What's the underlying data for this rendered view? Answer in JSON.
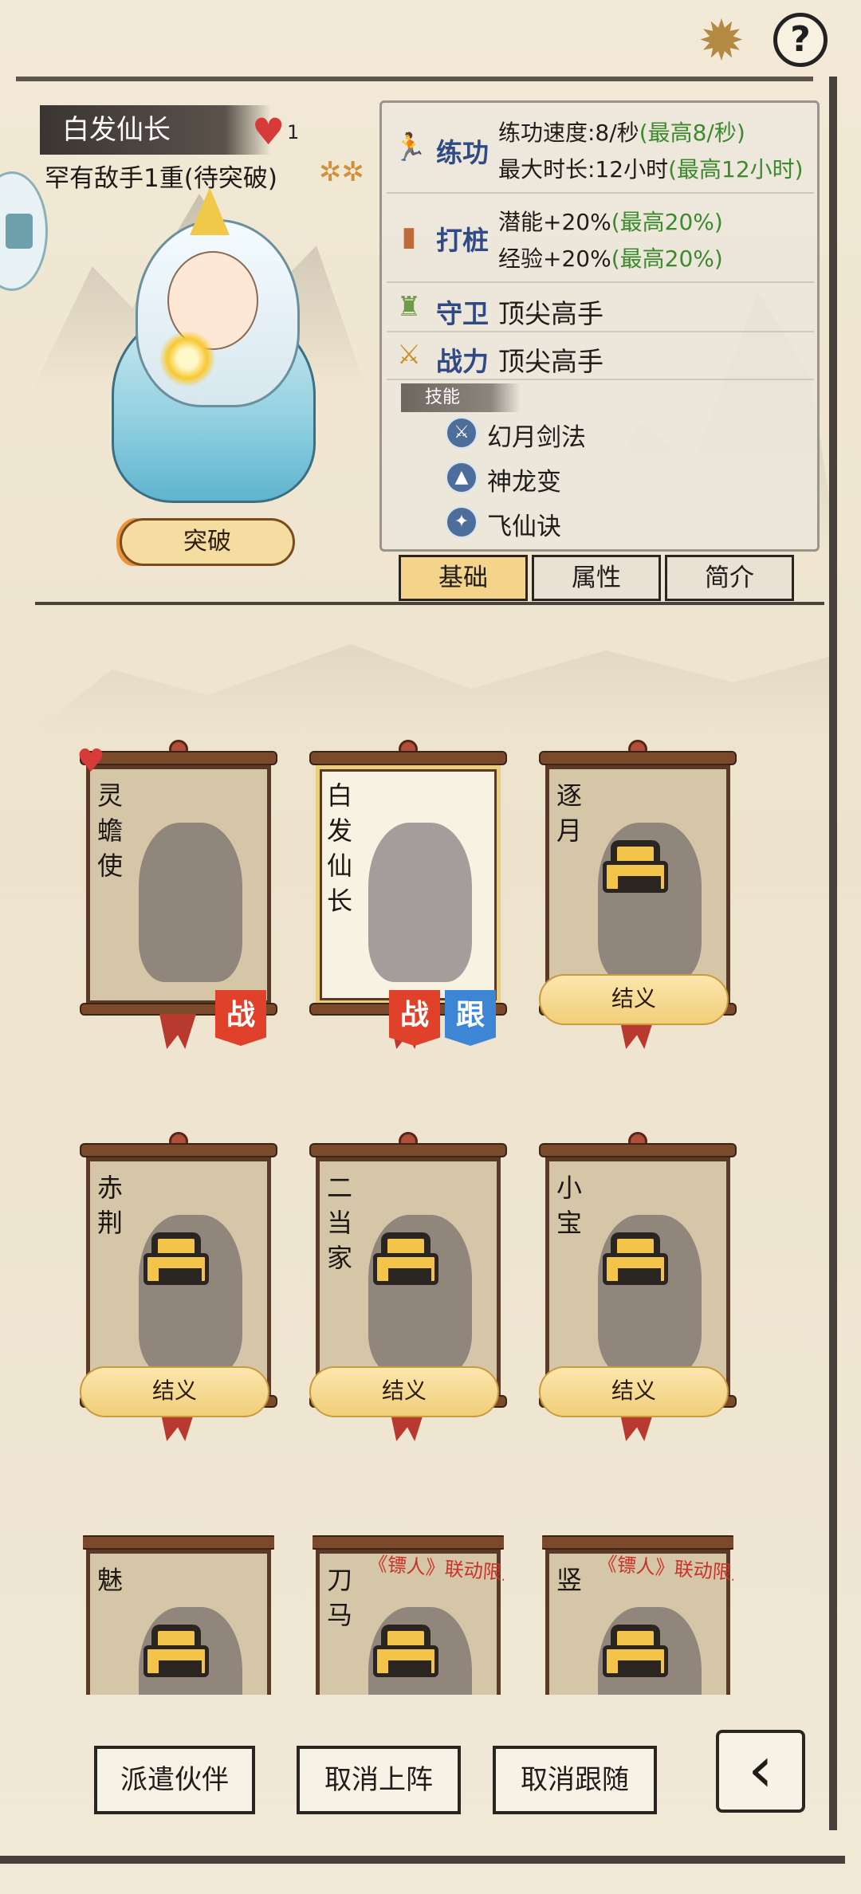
{
  "header": {
    "character_name": "白发仙长",
    "heart_count": "1",
    "subtitle": "罕有敌手1重(待突破)",
    "breakthrough_label": "突破"
  },
  "stats": {
    "training": {
      "label": "练功",
      "line1_text": "练功速度:8/秒",
      "line1_max": "(最高8/秒)",
      "line2_text": "最大时长:12小时",
      "line2_max": "(最高12小时)"
    },
    "stake": {
      "label": "打桩",
      "line1_text": "潜能+20%",
      "line1_max": "(最高20%)",
      "line2_text": "经验+20%",
      "line2_max": "(最高20%)"
    },
    "guard": {
      "label": "守卫",
      "value": "顶尖高手"
    },
    "power": {
      "label": "战力",
      "value": "顶尖高手"
    },
    "skills_label": "技能",
    "skills": [
      "幻月剑法",
      "神龙变",
      "飞仙诀"
    ]
  },
  "tabs": [
    {
      "label": "基础",
      "active": true
    },
    {
      "label": "属性",
      "active": false
    },
    {
      "label": "简介",
      "active": false
    }
  ],
  "cards": [
    {
      "name": "灵蟾使",
      "locked": false,
      "badges": [
        "战"
      ]
    },
    {
      "name": "白发仙长",
      "locked": false,
      "selected": true,
      "badges": [
        "战",
        "跟"
      ]
    },
    {
      "name": "逐月",
      "locked": true,
      "action": "结义"
    },
    {
      "name": "赤荆",
      "locked": true,
      "action": "结义"
    },
    {
      "name": "二当家",
      "locked": true,
      "action": "结义"
    },
    {
      "name": "小宝",
      "locked": true,
      "action": "结义"
    },
    {
      "name": "魅",
      "locked": true
    },
    {
      "name": "刀马",
      "locked": true,
      "collab": "《镖人》联动限定"
    },
    {
      "name": "竖",
      "locked": true,
      "collab": "《镖人》联动限定"
    }
  ],
  "bottom": {
    "dispatch": "派遣伙伴",
    "cancel_deploy": "取消上阵",
    "cancel_follow": "取消跟随",
    "back": "back-icon"
  },
  "icons": {
    "settings": "gear-icon",
    "help": "?"
  },
  "colors": {
    "accent_gold": "#f4d38a",
    "max_green": "#3c8a2e",
    "stat_blue": "#2f4a86",
    "badge_red": "#e0412a",
    "badge_blue": "#3d86d6"
  }
}
